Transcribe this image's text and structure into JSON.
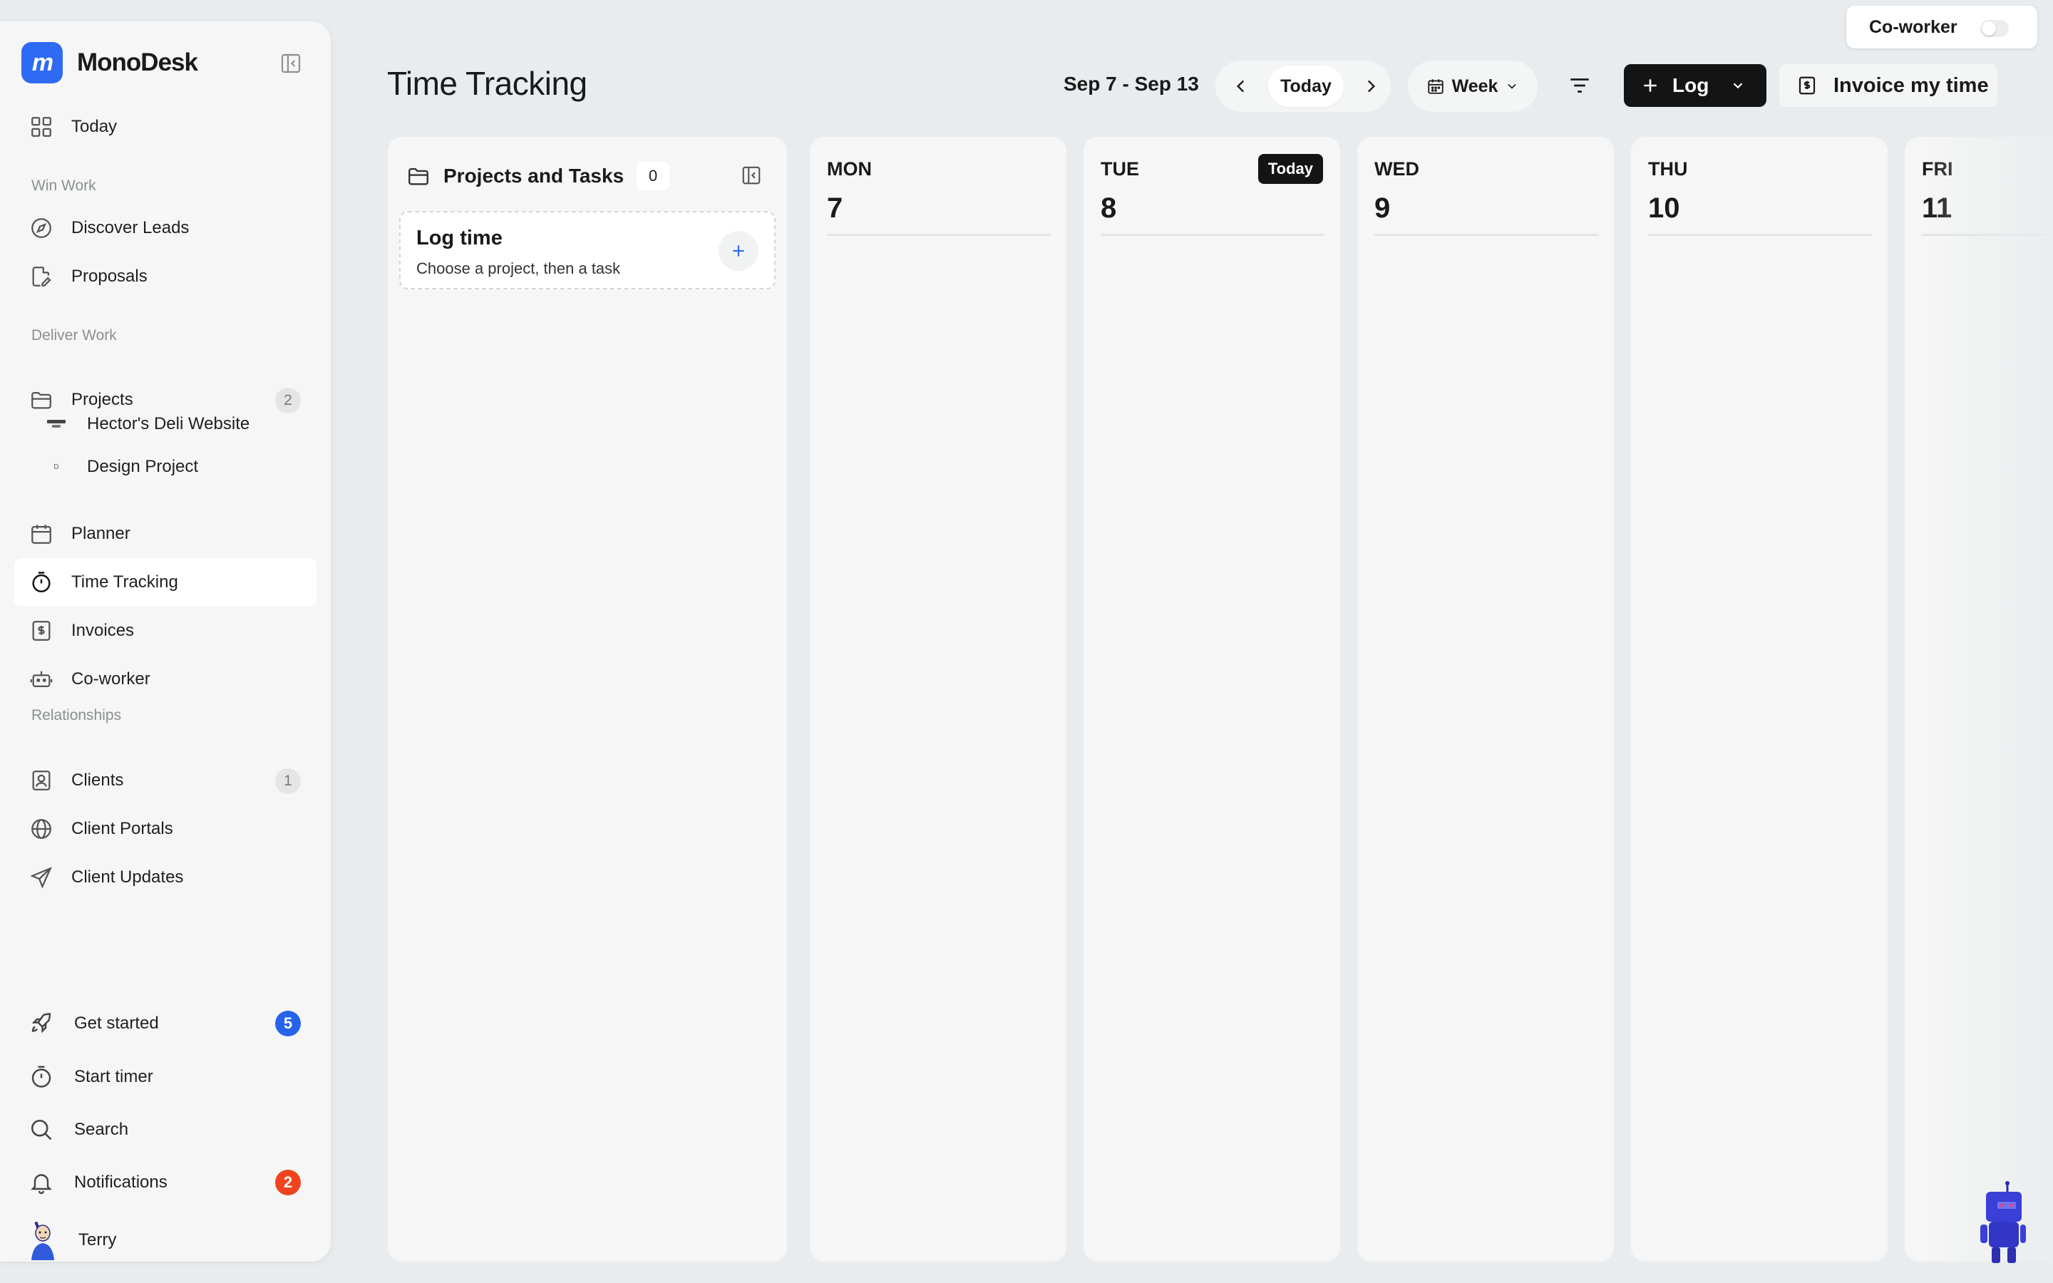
{
  "app": {
    "name": "MonoDesk",
    "logo_glyph": "m",
    "accent_color": "#2f6af5"
  },
  "sidebar": {
    "top_item": {
      "label": "Today",
      "icon": "grid-icon"
    },
    "sections": {
      "win_work": "Win Work",
      "deliver_work": "Deliver Work",
      "relationships": "Relationships"
    },
    "items": {
      "discover_leads": {
        "label": "Discover Leads",
        "icon": "compass-icon"
      },
      "proposals": {
        "label": "Proposals",
        "icon": "document-edit-icon"
      },
      "projects": {
        "label": "Projects",
        "icon": "folder-icon",
        "count": "2"
      },
      "planner": {
        "label": "Planner",
        "icon": "calendar-icon"
      },
      "time_tracking": {
        "label": "Time Tracking",
        "icon": "stopwatch-icon",
        "active": true
      },
      "invoices": {
        "label": "Invoices",
        "icon": "dollar-document-icon"
      },
      "coworker": {
        "label": "Co-worker",
        "icon": "robot-icon"
      },
      "clients": {
        "label": "Clients",
        "icon": "contact-card-icon",
        "count": "1"
      },
      "client_portals": {
        "label": "Client Portals",
        "icon": "globe-icon"
      },
      "client_updates": {
        "label": "Client Updates",
        "icon": "send-icon"
      }
    },
    "sub_projects": [
      {
        "label": "Hector's Deli Website",
        "thumb": "Hector's Deli"
      },
      {
        "label": "Design Project",
        "thumb": "D"
      }
    ],
    "bottom": {
      "get_started": {
        "label": "Get started",
        "icon": "rocket-icon",
        "count": "5",
        "badge_color": "#2563eb"
      },
      "start_timer": {
        "label": "Start timer",
        "icon": "stopwatch-icon"
      },
      "search": {
        "label": "Search",
        "icon": "search-icon"
      },
      "notifications": {
        "label": "Notifications",
        "icon": "bell-icon",
        "count": "2",
        "badge_color": "#f0441e"
      },
      "user": {
        "label": "Terry",
        "icon": "avatar"
      }
    }
  },
  "header": {
    "title": "Time Tracking",
    "date_range": "Sep 7 - Sep 13",
    "today_button": "Today",
    "view_select": "Week",
    "log_button": "Log",
    "invoice_button": "Invoice my time"
  },
  "coworker_toggle": {
    "label": "Co-worker",
    "enabled": false
  },
  "projects_panel": {
    "title": "Projects and Tasks",
    "count": "0",
    "log_card": {
      "title": "Log time",
      "subtitle": "Choose a project, then a task"
    }
  },
  "days": [
    {
      "name": "MON",
      "num": "7",
      "is_today": false
    },
    {
      "name": "TUE",
      "num": "8",
      "is_today": true,
      "today_label": "Today"
    },
    {
      "name": "WED",
      "num": "9",
      "is_today": false
    },
    {
      "name": "THU",
      "num": "10",
      "is_today": false
    },
    {
      "name": "FRI",
      "num": "11",
      "is_today": false
    }
  ]
}
